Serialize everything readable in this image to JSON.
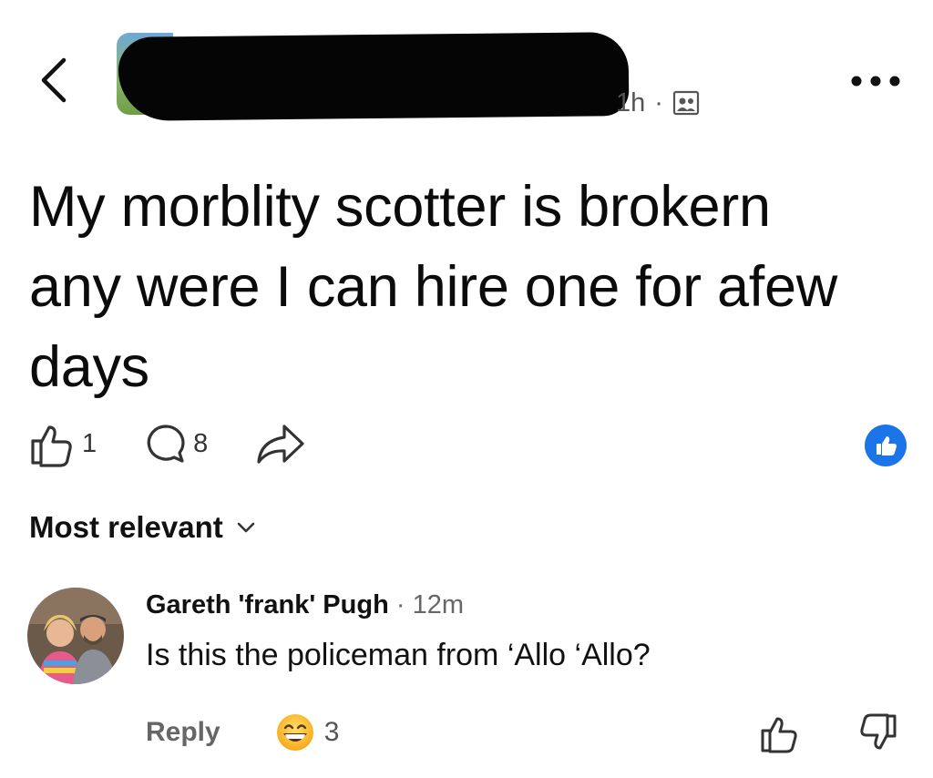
{
  "header": {
    "time": "1h",
    "separator": "·",
    "icons": [
      "back-chevron-icon",
      "group-icon",
      "more-icon"
    ]
  },
  "post": {
    "text": "My morblity scotter is brokern any were I can hire one for afew days",
    "like_count": "1",
    "comment_count": "8",
    "icons": [
      "thumbs-up-icon",
      "comment-icon",
      "share-icon",
      "like-badge-icon"
    ]
  },
  "comments_header": {
    "sort_label": "Most relevant"
  },
  "comment": {
    "author": "Gareth 'frank' Pugh",
    "separator": " · ",
    "time": "12m",
    "text": "Is this the policeman from ‘Allo ‘Allo?",
    "reply_label": "Reply",
    "reaction_count": "3",
    "reaction_icon": "grinning-emoji-icon"
  },
  "colors": {
    "accent": "#1b74e8",
    "text": "#111111",
    "muted": "#666666"
  }
}
